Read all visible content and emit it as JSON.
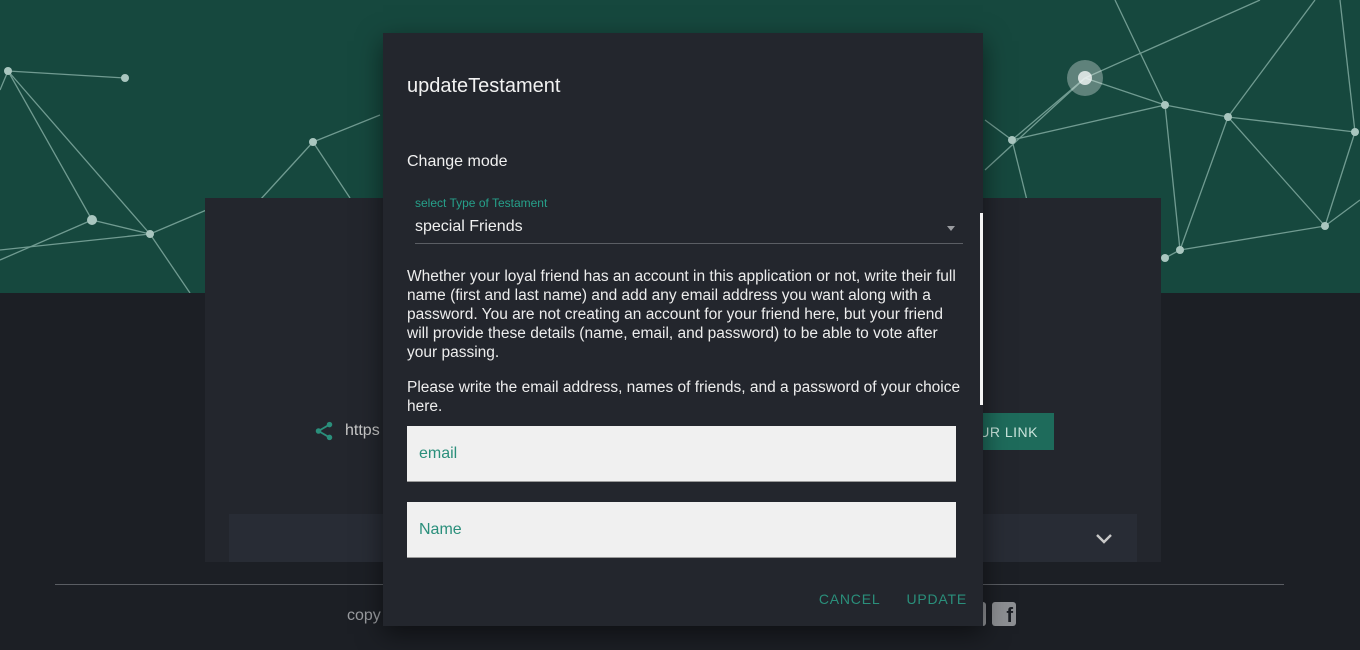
{
  "dialog": {
    "title": "updateTestament",
    "mode_label": "Change mode",
    "select": {
      "label": "select Type of Testament",
      "value": "special Friends"
    },
    "paragraph_1": "Whether your loyal friend has an account in this application or not, write their full name (first and last name) and add any email address you want along with a password. You are not creating an account for your friend here, but your friend will provide these details (name, email, and password) to be able to vote after your passing.",
    "paragraph_2": "Please write the email address, names of friends, and a password of your choice here.",
    "email_placeholder": "email",
    "name_placeholder": "Name",
    "cancel_label": "CANCEL",
    "update_label": "UPDATE"
  },
  "background": {
    "share_text": "https",
    "link_button_label": "UR LINK",
    "copyright_text": "copy"
  },
  "colors": {
    "accent": "#2a8f7b",
    "hero": "#16483e",
    "dialog_bg": "#23262d",
    "page_bg": "#1c1f25"
  },
  "icons": [
    "share-icon",
    "chevron-down-icon",
    "social-icon",
    "facebook-icon"
  ]
}
